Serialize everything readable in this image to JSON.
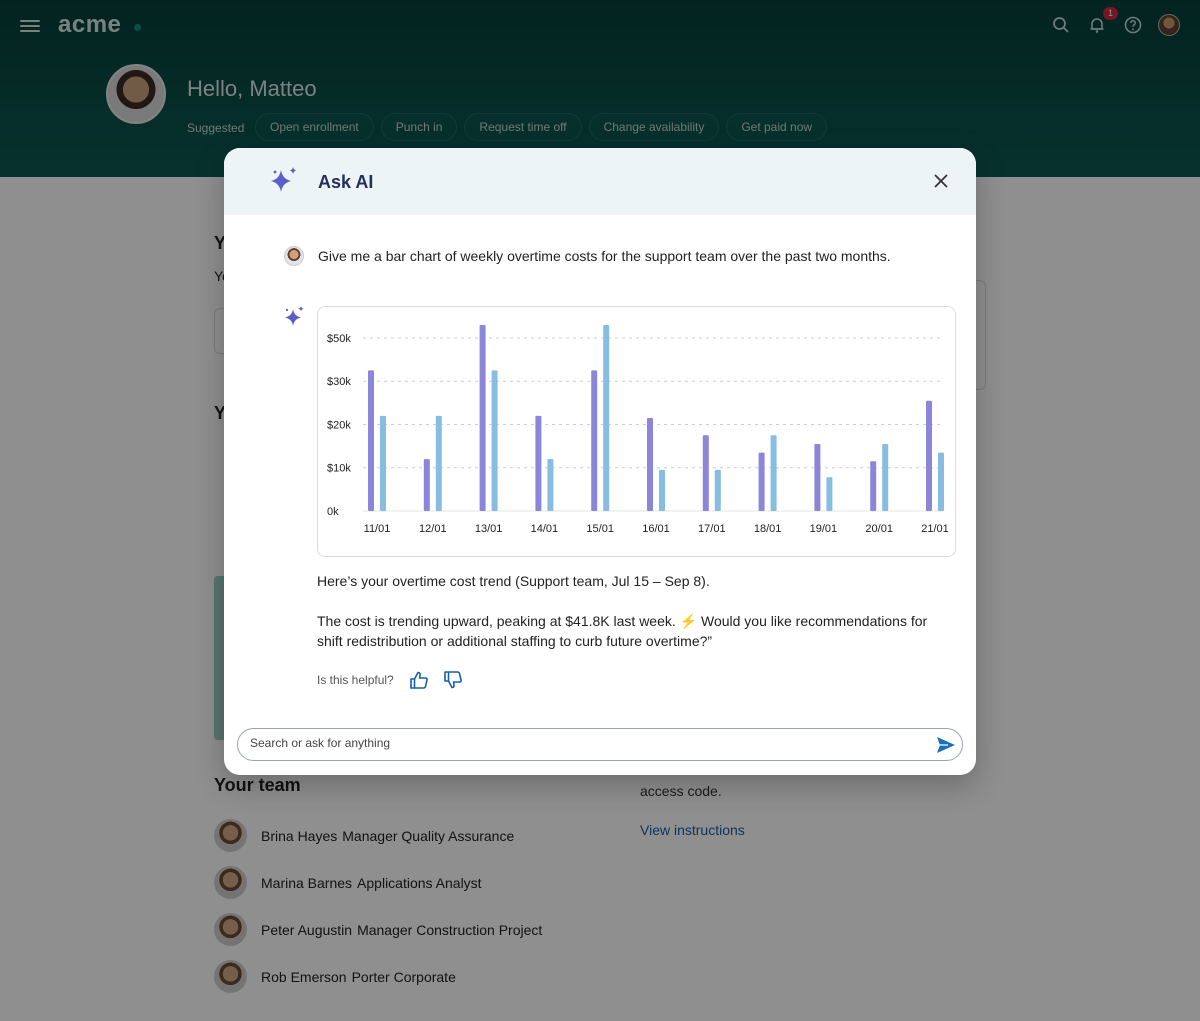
{
  "app": {
    "logo": "acme",
    "notification_count": "1",
    "greeting": "Hello, Matteo",
    "suggested_label": "Suggested",
    "suggestions": [
      "Open enrollment",
      "Punch in",
      "Request time off",
      "Change availability",
      "Get paid now"
    ],
    "team_title": "Your team",
    "team": [
      {
        "name": "Brina Hayes",
        "role": "Manager Quality Assurance"
      },
      {
        "name": "Marina Barnes",
        "role": "Applications Analyst"
      },
      {
        "name": "Peter Augustin",
        "role": "Manager Construction Project"
      },
      {
        "name": "Rob Emerson",
        "role": "Porter Corporate"
      }
    ],
    "side_text": "access code.",
    "side_link": "View instructions",
    "fragment_y": "Y",
    "fragment_yo": "Yo"
  },
  "modal": {
    "title": "Ask AI",
    "user_prompt": "Give me a bar chart of weekly overtime costs for the support team over the past two months.",
    "response_1": "Here’s your overtime cost trend (Support team, Jul 15 – Sep 8).",
    "response_2a": "The cost is trending upward, peaking at $41.8K last week.",
    "response_bolt": "⚡",
    "response_2b": "Would you like recommendations for shift redistribution or additional staffing to curb future overtime?”",
    "helpful_label": "Is this helpful?",
    "search_placeholder": "Search or ask for anything"
  },
  "chart_data": {
    "type": "bar",
    "categories": [
      "11/01",
      "12/01",
      "13/01",
      "14/01",
      "15/01",
      "16/01",
      "17/01",
      "18/01",
      "19/01",
      "20/01",
      "21/01"
    ],
    "y_ticks": [
      {
        "label": "0k",
        "value": 0
      },
      {
        "label": "$10k",
        "value": 10000
      },
      {
        "label": "$20k",
        "value": 20000
      },
      {
        "label": "$30k",
        "value": 30000
      },
      {
        "label": "$50k",
        "value": 40000
      }
    ],
    "ylim": [
      0,
      43000
    ],
    "grid": true,
    "series": [
      {
        "color": "#8b86d9",
        "values": [
          32500,
          12000,
          43000,
          22000,
          32500,
          21500,
          17500,
          13500,
          15500,
          11500,
          25500
        ]
      },
      {
        "color": "#86bde0",
        "values": [
          22000,
          22000,
          32500,
          12000,
          43000,
          9500,
          9500,
          17500,
          7800,
          15500,
          13500
        ]
      }
    ]
  },
  "colors": {
    "header": "#063f3a",
    "ai_accent": "#5b5fc7",
    "send": "#1a6fb8",
    "thumb": "#1a5fa8"
  }
}
